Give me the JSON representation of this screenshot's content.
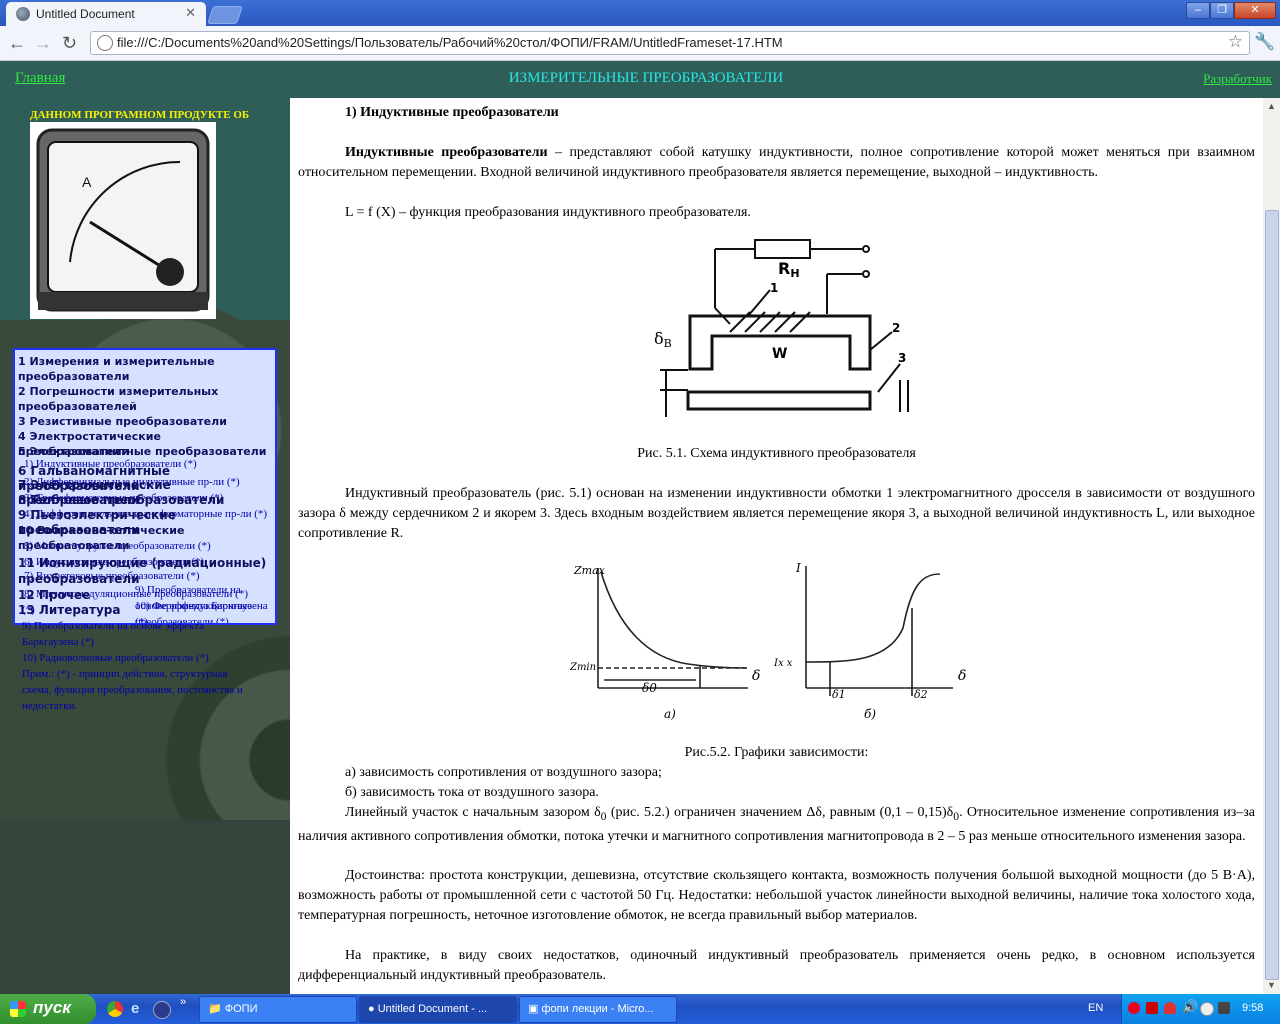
{
  "browser": {
    "tab_title": "Untitled Document",
    "tab_close": "✕",
    "url": "file:///C:/Documents%20and%20Settings/Пользователь/Рабочий%20стол/ФОПИ/FRAM/UntitledFrameset-17.HTM",
    "window_buttons": [
      "–",
      "❐",
      "✕"
    ]
  },
  "top_frame": {
    "home_link": "Главная",
    "title": "ИЗМЕРИТЕЛЬНЫЕ ПРЕОБРАЗОВАТЕЛИ",
    "developer_link": "Разработчик"
  },
  "left_frame": {
    "marquee": "ДАННОМ ПРОГРАМНОМ ПРОДУКТЕ ОБ",
    "menu_items": [
      "1 Измерения и измерительные",
      "преобразователи",
      "2 Погрешности измерительных",
      "преобразователей",
      "3 Резистивные преобразователи",
      "4 Электростатические преобразователи",
      "5 Электромагнитные преобразователи",
      "6 Гальваномагнитные преобразователи",
      "7 Электрохимические преобразователи",
      "8 Тепловые преобразователи",
      "9 Пьезоэлектрические преобразователи",
      "10 Волоконно-оптические",
      "преобразователи",
      "11 Ионизирующие (радиационные)",
      "преобразователи",
      "12 Прочее",
      "13 Литература"
    ],
    "submenu": [
      "1) Индуктивные преобразователи (*)",
      "2) Дифференциальные индуктивные пр-ли (*)",
      "3) Трансформаторные преобразователи (*)",
      "4) Дифференциальные трансформаторные пр-ли (*)",
      "5) Магнитоупругие преобразователи (*)",
      "6) Индукционные преобразователи (*)",
      "7) Вихретоковые преобразователи (*)",
      "8) Магнитомодуляционные преобразователи (*)",
      "9) Преобразователи на основе эффекта Баркгаузена (*)",
      "10) Ферроиндукционные преобразователи (*)"
    ],
    "sub_overflow": [
      "(*)",
      "9) Преобразователи на основе эффекта",
      "Баркгаузена (*)",
      "10) Радиоволновые преобразователи (*)",
      "Прим.: (*) - принцип действия, структурная",
      "схема, функция преобразования, постоянства и",
      "недостатки."
    ]
  },
  "content": {
    "heading": "1) Индуктивные преобразователи",
    "p1_bold": "Индуктивные преобразователи",
    "p1_rest": " – представляют собой катушку индуктивности, полное сопротивление которой может меняться при взаимном относительном перемещении. Входной величиной индуктивного преобразователя является перемещение, выходной – индуктивность.",
    "p2": "L = f (X) – функция преобразования индуктивного преобразователя.",
    "fig1": {
      "label_r": "R",
      "label_r_sub": "Н",
      "label_w": "W",
      "label_1": "1",
      "label_2": "2",
      "label_3": "3",
      "label_delta": "δ",
      "label_delta_sub": "В",
      "caption": "Рис. 5.1. Схема индуктивного преобразователя"
    },
    "p3": "Индуктивный преобразователь (рис. 5.1) основан на изменении индуктивности обмотки 1 электромагнитного дросселя в зависимости от воздушного зазора δ между сердечником 2 и якорем 3. Здесь входным воздействием является перемещение якоря 3, а выходной величиной индуктивность L, или выходное сопротивление R.",
    "fig2": {
      "a_y": "Zmax",
      "a_min": "Zmin",
      "a_x": "δ",
      "a_d0": "δ0",
      "a_cap": "а)",
      "b_y": "I",
      "b_ixx": "Iх х",
      "b_x": "δ",
      "b_d1": "δ1",
      "b_d2": "δ2",
      "b_cap": "б)",
      "caption": "Рис.5.2. Графики зависимости:"
    },
    "l1": "а) зависимость сопротивления от воздушного зазора;",
    "l2": "б) зависимость тока от воздушного зазора.",
    "p4a": "Линейный участок с начальным зазором δ",
    "p4sub": "0",
    "p4b": " (рис. 5.2.) ограничен значением Δδ, равным (0,1 – 0,15)δ",
    "p4sub2": "0",
    "p4c": ". Относительное изменение сопротивления из–за наличия активного сопротивления обмотки, потока утечки и магнитного сопротивления магнитопровода в 2 – 5 раз меньше относительного изменения зазора.",
    "p5": "Достоинства: простота конструкции, дешевизна, отсутствие скользящего контакта, возможность получения большой выходной мощности (до 5 В·А), возможность работы от промышленной сети с частотой 50 Гц. Недостатки: небольшой участок линейности выходной величины, наличие тока холостого хода, температурная погрешность, неточное изготовление обмоток, не всегда  правильный выбор материалов.",
    "p6": "На практике, в виду своих недостатков, одиночный индуктивный преобразователь применяется очень редко, в основном используется дифференциальный индуктивный преобразователь."
  },
  "taskbar": {
    "start": "пуск",
    "buttons": [
      "ФОПИ",
      "Untitled Document - ...",
      "фопи лекции - Micro..."
    ],
    "lang": "EN",
    "clock": "9:58"
  }
}
